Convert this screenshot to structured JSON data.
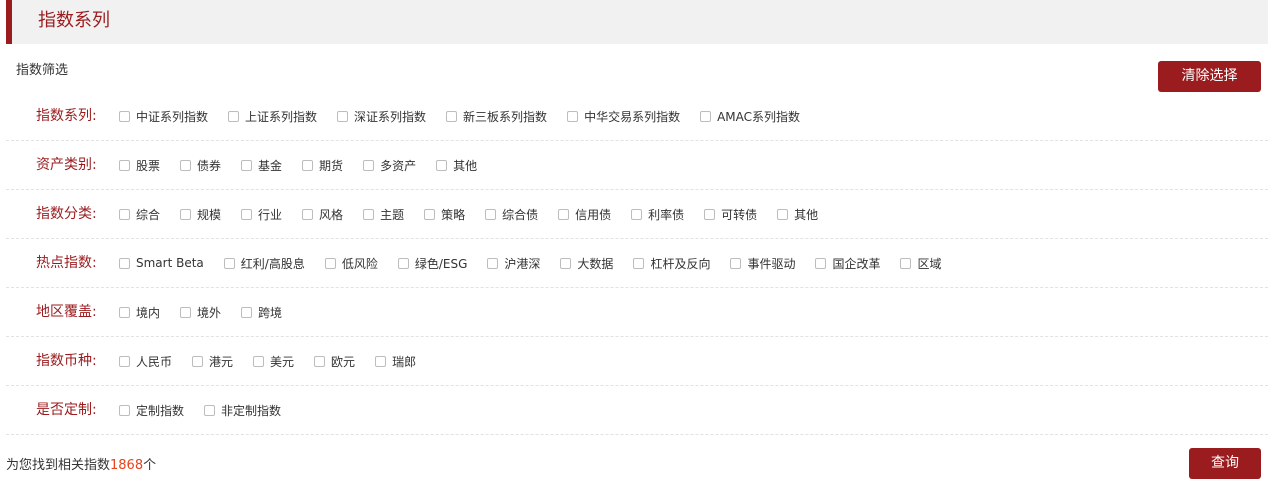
{
  "header": {
    "title": "指数系列"
  },
  "filter_section": {
    "label": "指数筛选",
    "clear_button": "清除选择"
  },
  "rows": [
    {
      "label": "指数系列:",
      "options": [
        "中证系列指数",
        "上证系列指数",
        "深证系列指数",
        "新三板系列指数",
        "中华交易系列指数",
        "AMAC系列指数"
      ]
    },
    {
      "label": "资产类别:",
      "options": [
        "股票",
        "债券",
        "基金",
        "期货",
        "多资产",
        "其他"
      ]
    },
    {
      "label": "指数分类:",
      "options": [
        "综合",
        "规模",
        "行业",
        "风格",
        "主题",
        "策略",
        "综合债",
        "信用债",
        "利率债",
        "可转债",
        "其他"
      ]
    },
    {
      "label": "热点指数:",
      "options": [
        "Smart Beta",
        "红利/高股息",
        "低风险",
        "绿色/ESG",
        "沪港深",
        "大数据",
        "杠杆及反向",
        "事件驱动",
        "国企改革",
        "区域"
      ]
    },
    {
      "label": "地区覆盖:",
      "options": [
        "境内",
        "境外",
        "跨境"
      ]
    },
    {
      "label": "指数币种:",
      "options": [
        "人民币",
        "港元",
        "美元",
        "欧元",
        "瑞郎"
      ]
    },
    {
      "label": "是否定制:",
      "options": [
        "定制指数",
        "非定制指数"
      ]
    }
  ],
  "result": {
    "prefix": "为您找到相关指数",
    "count": "1868",
    "suffix": "个"
  },
  "query_button": "查询",
  "colors": {
    "accent": "#9b1c1f",
    "count_highlight": "#e8431a"
  }
}
